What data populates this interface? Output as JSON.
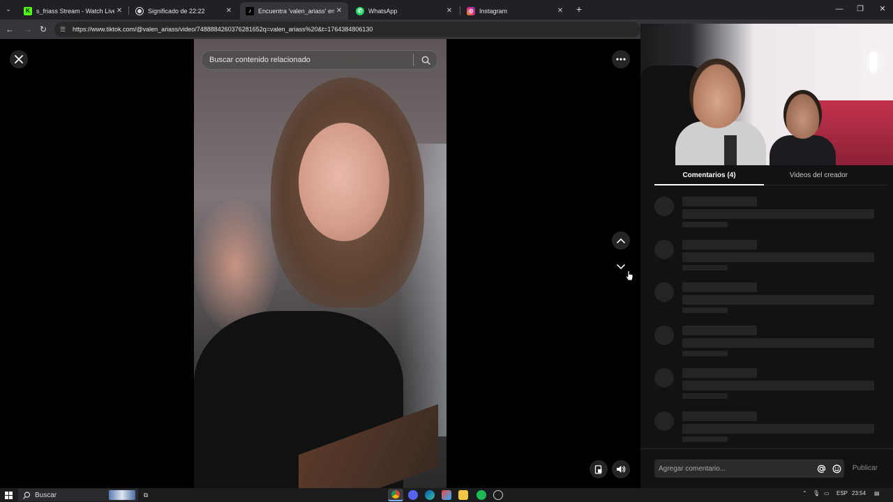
{
  "browser": {
    "tabs": [
      {
        "title": "s_friass Stream - Watch Live on",
        "icon": "kick-icon",
        "active": false
      },
      {
        "title": "Significado de 22:22",
        "icon": "chatgpt-icon",
        "active": false
      },
      {
        "title": "Encuentra 'valen_ariass' en Tik",
        "icon": "tiktok-icon",
        "active": true
      },
      {
        "title": "WhatsApp",
        "icon": "whatsapp-icon",
        "active": false
      },
      {
        "title": "Instagram",
        "icon": "instagram-icon",
        "active": false
      }
    ],
    "url": "https://www.tiktok.com/@valen_ariass/video/7488884260376281652q=valen_ariass%20&t=1764384806130"
  },
  "video_view": {
    "search_placeholder": "Buscar contenido relacionado"
  },
  "comments_panel": {
    "tab_comments": "Comentarios (4)",
    "tab_creator_videos": "Videos del creador",
    "skeleton_rows": 6,
    "comment_placeholder": "Agregar comentario...",
    "publish_label": "Publicar"
  },
  "taskbar": {
    "search_label": "Buscar",
    "language": "ESP",
    "time": "23:54"
  },
  "colors": {
    "tab_strip": "#202124",
    "toolbar": "#35363a",
    "panel_bg": "#121212",
    "skeleton": "#242424"
  }
}
